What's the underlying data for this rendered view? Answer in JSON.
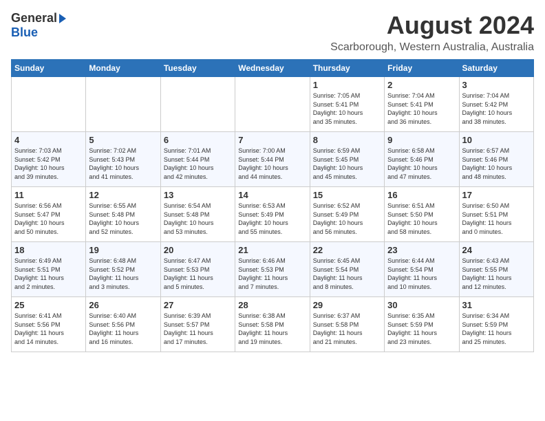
{
  "header": {
    "logo_general": "General",
    "logo_blue": "Blue",
    "title": "August 2024",
    "subtitle": "Scarborough, Western Australia, Australia"
  },
  "days_of_week": [
    "Sunday",
    "Monday",
    "Tuesday",
    "Wednesday",
    "Thursday",
    "Friday",
    "Saturday"
  ],
  "weeks": [
    [
      {
        "day": "",
        "detail": ""
      },
      {
        "day": "",
        "detail": ""
      },
      {
        "day": "",
        "detail": ""
      },
      {
        "day": "",
        "detail": ""
      },
      {
        "day": "1",
        "detail": "Sunrise: 7:05 AM\nSunset: 5:41 PM\nDaylight: 10 hours\nand 35 minutes."
      },
      {
        "day": "2",
        "detail": "Sunrise: 7:04 AM\nSunset: 5:41 PM\nDaylight: 10 hours\nand 36 minutes."
      },
      {
        "day": "3",
        "detail": "Sunrise: 7:04 AM\nSunset: 5:42 PM\nDaylight: 10 hours\nand 38 minutes."
      }
    ],
    [
      {
        "day": "4",
        "detail": "Sunrise: 7:03 AM\nSunset: 5:42 PM\nDaylight: 10 hours\nand 39 minutes."
      },
      {
        "day": "5",
        "detail": "Sunrise: 7:02 AM\nSunset: 5:43 PM\nDaylight: 10 hours\nand 41 minutes."
      },
      {
        "day": "6",
        "detail": "Sunrise: 7:01 AM\nSunset: 5:44 PM\nDaylight: 10 hours\nand 42 minutes."
      },
      {
        "day": "7",
        "detail": "Sunrise: 7:00 AM\nSunset: 5:44 PM\nDaylight: 10 hours\nand 44 minutes."
      },
      {
        "day": "8",
        "detail": "Sunrise: 6:59 AM\nSunset: 5:45 PM\nDaylight: 10 hours\nand 45 minutes."
      },
      {
        "day": "9",
        "detail": "Sunrise: 6:58 AM\nSunset: 5:46 PM\nDaylight: 10 hours\nand 47 minutes."
      },
      {
        "day": "10",
        "detail": "Sunrise: 6:57 AM\nSunset: 5:46 PM\nDaylight: 10 hours\nand 48 minutes."
      }
    ],
    [
      {
        "day": "11",
        "detail": "Sunrise: 6:56 AM\nSunset: 5:47 PM\nDaylight: 10 hours\nand 50 minutes."
      },
      {
        "day": "12",
        "detail": "Sunrise: 6:55 AM\nSunset: 5:48 PM\nDaylight: 10 hours\nand 52 minutes."
      },
      {
        "day": "13",
        "detail": "Sunrise: 6:54 AM\nSunset: 5:48 PM\nDaylight: 10 hours\nand 53 minutes."
      },
      {
        "day": "14",
        "detail": "Sunrise: 6:53 AM\nSunset: 5:49 PM\nDaylight: 10 hours\nand 55 minutes."
      },
      {
        "day": "15",
        "detail": "Sunrise: 6:52 AM\nSunset: 5:49 PM\nDaylight: 10 hours\nand 56 minutes."
      },
      {
        "day": "16",
        "detail": "Sunrise: 6:51 AM\nSunset: 5:50 PM\nDaylight: 10 hours\nand 58 minutes."
      },
      {
        "day": "17",
        "detail": "Sunrise: 6:50 AM\nSunset: 5:51 PM\nDaylight: 11 hours\nand 0 minutes."
      }
    ],
    [
      {
        "day": "18",
        "detail": "Sunrise: 6:49 AM\nSunset: 5:51 PM\nDaylight: 11 hours\nand 2 minutes."
      },
      {
        "day": "19",
        "detail": "Sunrise: 6:48 AM\nSunset: 5:52 PM\nDaylight: 11 hours\nand 3 minutes."
      },
      {
        "day": "20",
        "detail": "Sunrise: 6:47 AM\nSunset: 5:53 PM\nDaylight: 11 hours\nand 5 minutes."
      },
      {
        "day": "21",
        "detail": "Sunrise: 6:46 AM\nSunset: 5:53 PM\nDaylight: 11 hours\nand 7 minutes."
      },
      {
        "day": "22",
        "detail": "Sunrise: 6:45 AM\nSunset: 5:54 PM\nDaylight: 11 hours\nand 8 minutes."
      },
      {
        "day": "23",
        "detail": "Sunrise: 6:44 AM\nSunset: 5:54 PM\nDaylight: 11 hours\nand 10 minutes."
      },
      {
        "day": "24",
        "detail": "Sunrise: 6:43 AM\nSunset: 5:55 PM\nDaylight: 11 hours\nand 12 minutes."
      }
    ],
    [
      {
        "day": "25",
        "detail": "Sunrise: 6:41 AM\nSunset: 5:56 PM\nDaylight: 11 hours\nand 14 minutes."
      },
      {
        "day": "26",
        "detail": "Sunrise: 6:40 AM\nSunset: 5:56 PM\nDaylight: 11 hours\nand 16 minutes."
      },
      {
        "day": "27",
        "detail": "Sunrise: 6:39 AM\nSunset: 5:57 PM\nDaylight: 11 hours\nand 17 minutes."
      },
      {
        "day": "28",
        "detail": "Sunrise: 6:38 AM\nSunset: 5:58 PM\nDaylight: 11 hours\nand 19 minutes."
      },
      {
        "day": "29",
        "detail": "Sunrise: 6:37 AM\nSunset: 5:58 PM\nDaylight: 11 hours\nand 21 minutes."
      },
      {
        "day": "30",
        "detail": "Sunrise: 6:35 AM\nSunset: 5:59 PM\nDaylight: 11 hours\nand 23 minutes."
      },
      {
        "day": "31",
        "detail": "Sunrise: 6:34 AM\nSunset: 5:59 PM\nDaylight: 11 hours\nand 25 minutes."
      }
    ]
  ]
}
